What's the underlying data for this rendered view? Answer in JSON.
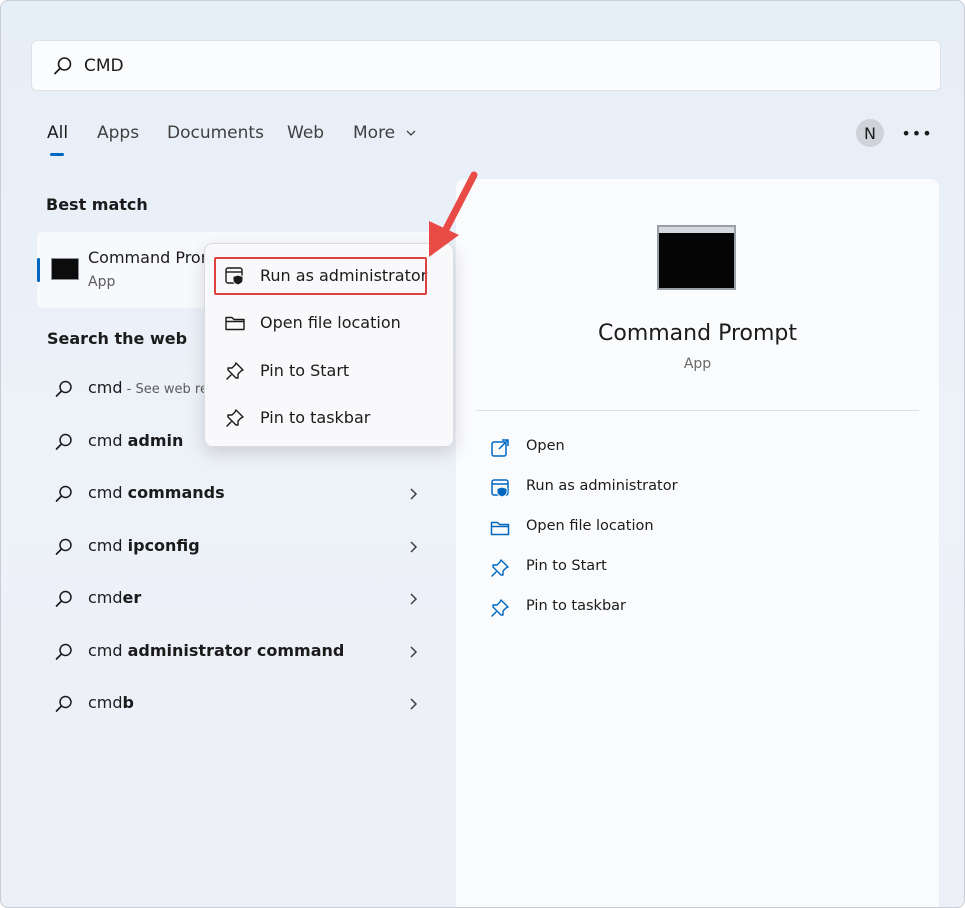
{
  "search": {
    "value": "CMD"
  },
  "tabs": [
    {
      "label": "All",
      "active": true
    },
    {
      "label": "Apps"
    },
    {
      "label": "Documents"
    },
    {
      "label": "Web"
    },
    {
      "label": "More"
    }
  ],
  "account": {
    "initial": "N"
  },
  "more_options": "•••",
  "best_match": {
    "heading": "Best match",
    "title": "Command Prompt",
    "subtitle": "App"
  },
  "web": {
    "heading": "Search the web",
    "items": [
      {
        "prefix": "cmd",
        "bold": "",
        "hint": " - See web results"
      },
      {
        "prefix": "cmd ",
        "bold": "admin",
        "hint": ""
      },
      {
        "prefix": "cmd ",
        "bold": "commands",
        "hint": ""
      },
      {
        "prefix": "cmd ",
        "bold": "ipconfig",
        "hint": ""
      },
      {
        "prefix": "cmd",
        "bold": "er",
        "hint": ""
      },
      {
        "prefix": "cmd ",
        "bold": "administrator command",
        "hint": ""
      },
      {
        "prefix": "cmd",
        "bold": "b",
        "hint": ""
      }
    ]
  },
  "context_menu": {
    "items": [
      {
        "label": "Run as administrator",
        "icon": "shield-window-icon"
      },
      {
        "label": "Open file location",
        "icon": "folder-icon"
      },
      {
        "label": "Pin to Start",
        "icon": "pin-icon"
      },
      {
        "label": "Pin to taskbar",
        "icon": "pin-icon"
      }
    ]
  },
  "detail": {
    "app_name": "Command Prompt",
    "app_type": "App",
    "actions": [
      {
        "label": "Open",
        "icon": "open-external-icon"
      },
      {
        "label": "Run as administrator",
        "icon": "shield-window-icon"
      },
      {
        "label": "Open file location",
        "icon": "folder-icon"
      },
      {
        "label": "Pin to Start",
        "icon": "pin-icon"
      },
      {
        "label": "Pin to taskbar",
        "icon": "pin-icon"
      }
    ]
  },
  "colors": {
    "accent": "#0067c0",
    "annotation": "#e0403f"
  }
}
